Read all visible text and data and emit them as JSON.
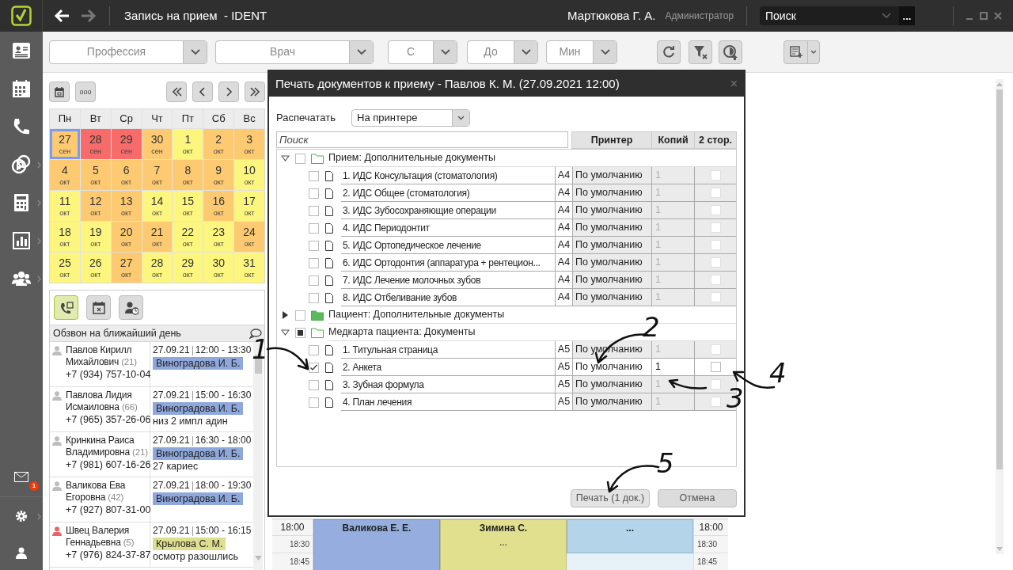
{
  "title_bar": {
    "title": "Запись на прием  - IDENT",
    "user": "Мартюкова Г. А.",
    "role": "Администратор",
    "search": {
      "value": "Поиск",
      "more": "..."
    }
  },
  "sidebar": {
    "mail_badge": "1"
  },
  "toolbar": {
    "filters": [
      {
        "placeholder": "Профессия"
      },
      {
        "placeholder": "Врач"
      },
      {
        "placeholder": "С"
      },
      {
        "placeholder": "До"
      },
      {
        "placeholder": "Мин"
      }
    ]
  },
  "calendar": {
    "more": "ooo",
    "weekdays": [
      "Пн",
      "Вт",
      "Ср",
      "Чт",
      "Пт",
      "Сб",
      "Вс"
    ],
    "days": [
      {
        "day": "27",
        "month": "сен",
        "color": "#fdca72",
        "selected": true
      },
      {
        "day": "28",
        "month": "сен",
        "color": "#f76b6b",
        "selected": false
      },
      {
        "day": "29",
        "month": "сен",
        "color": "#f76b6b",
        "selected": false
      },
      {
        "day": "30",
        "month": "сен",
        "color": "#fdca72",
        "selected": false
      },
      {
        "day": "1",
        "month": "окт",
        "color": "#fdf67e",
        "selected": false
      },
      {
        "day": "2",
        "month": "окт",
        "color": "#fdca72",
        "selected": false
      },
      {
        "day": "3",
        "month": "окт",
        "color": "#fdca72",
        "selected": false
      },
      {
        "day": "4",
        "month": "окт",
        "color": "#fdca72",
        "selected": false
      },
      {
        "day": "5",
        "month": "окт",
        "color": "#fdca72",
        "selected": false
      },
      {
        "day": "6",
        "month": "окт",
        "color": "#fdca72",
        "selected": false
      },
      {
        "day": "7",
        "month": "окт",
        "color": "#fdca72",
        "selected": false
      },
      {
        "day": "8",
        "month": "окт",
        "color": "#fdca72",
        "selected": false
      },
      {
        "day": "9",
        "month": "окт",
        "color": "#fdca72",
        "selected": false
      },
      {
        "day": "10",
        "month": "окт",
        "color": "#fdf67e",
        "selected": false
      },
      {
        "day": "11",
        "month": "окт",
        "color": "#fdf67e",
        "selected": false
      },
      {
        "day": "12",
        "month": "окт",
        "color": "#fdca72",
        "selected": false
      },
      {
        "day": "13",
        "month": "окт",
        "color": "#fdca72",
        "selected": false
      },
      {
        "day": "14",
        "month": "окт",
        "color": "#fdf67e",
        "selected": false
      },
      {
        "day": "15",
        "month": "окт",
        "color": "#fdf67e",
        "selected": false
      },
      {
        "day": "16",
        "month": "окт",
        "color": "#fdca72",
        "selected": false
      },
      {
        "day": "17",
        "month": "окт",
        "color": "#fdf67e",
        "selected": false
      },
      {
        "day": "18",
        "month": "окт",
        "color": "#fdf67e",
        "selected": false
      },
      {
        "day": "19",
        "month": "окт",
        "color": "#fdf67e",
        "selected": false
      },
      {
        "day": "20",
        "month": "окт",
        "color": "#fdca72",
        "selected": false
      },
      {
        "day": "21",
        "month": "окт",
        "color": "#fdca72",
        "selected": false
      },
      {
        "day": "22",
        "month": "окт",
        "color": "#fdf67e",
        "selected": false
      },
      {
        "day": "23",
        "month": "окт",
        "color": "#fdf67e",
        "selected": false
      },
      {
        "day": "24",
        "month": "окт",
        "color": "#fdca72",
        "selected": false
      },
      {
        "day": "25",
        "month": "окт",
        "color": "#fdf67e",
        "selected": false
      },
      {
        "day": "26",
        "month": "окт",
        "color": "#fdf67e",
        "selected": false
      },
      {
        "day": "27",
        "month": "окт",
        "color": "#fdca72",
        "selected": false
      },
      {
        "day": "28",
        "month": "окт",
        "color": "#fdf67e",
        "selected": false
      },
      {
        "day": "29",
        "month": "окт",
        "color": "#fdf67e",
        "selected": false
      },
      {
        "day": "30",
        "month": "окт",
        "color": "#fdf67e",
        "selected": false
      },
      {
        "day": "31",
        "month": "окт",
        "color": "#fdf67e",
        "selected": false
      }
    ]
  },
  "call_list": {
    "tabs": [
      {
        "selected": true
      },
      {
        "selected": false
      },
      {
        "selected": false
      }
    ],
    "title": "Обзвон на ближайший день",
    "patients": [
      {
        "name": "Павлов Кирилл Михайлович",
        "age": "(21)",
        "phone": "+7 (934) 757-10-04",
        "date": "27.09.21",
        "time": "12:00 - 13:30",
        "doctor": {
          "name": "Виноградова И. Б.",
          "color": "#8fa8dc"
        },
        "person_icon": {
          "color": "#bdbdbd"
        }
      },
      {
        "name": "Павлова Лидия Исмаиловна",
        "age": "(66)",
        "phone": "+7 (965) 357-26-06",
        "date": "27.09.21",
        "time": "15:00 - 16:30",
        "doctor": {
          "name": "Виноградова И. Б.",
          "color": "#8fa8dc"
        },
        "note": "низ 2 импл адин",
        "person_icon": {
          "color": "#bdbdbd"
        }
      },
      {
        "name": "Кринкина Раиса Владимировна",
        "age": "(21)",
        "phone": "+7 (981) 607-16-26",
        "date": "27.09.21",
        "time": "16:30 - 18:00",
        "doctor": {
          "name": "Виноградова И. Б.",
          "color": "#8fa8dc"
        },
        "note": "27 кариес",
        "person_icon": {
          "color": "#bdbdbd"
        }
      },
      {
        "name": "Валикова Ева Егоровна",
        "age": "(42)",
        "phone": "+7 (927) 807-31-00",
        "date": "27.09.21",
        "time": "18:00 - 19:30",
        "doctor": {
          "name": "Виноградова И. Б.",
          "color": "#8fa8dc"
        },
        "person_icon": {
          "color": "#bdbdbd"
        }
      },
      {
        "name": "Швец Валерия Геннадьевна",
        "age": "(5)",
        "phone": "+7 (976) 824-37-87",
        "date": "27.09.21",
        "time": "15:00 - 16:15",
        "doctor": {
          "name": "Крылова С. М.",
          "color": "#dede8e"
        },
        "note": "осмотр разошлись",
        "person_icon": {
          "color": "#f06060"
        }
      }
    ]
  },
  "dialog": {
    "title": "Печать документов к приему - Павлов К. М. (27.09.2021 12:00)",
    "close": "×",
    "print_label": "Распечатать",
    "print_target": "На принтере",
    "search": {
      "placeholder": "Поиск"
    },
    "columns": [
      "Принтер",
      "Копий",
      "2 стор."
    ],
    "groups": [
      {
        "label": "Прием: Дополнительные документы",
        "expanded": true,
        "checked": false,
        "partial": false,
        "children": [
          {
            "label": "1. ИДС Консультация (стоматология)",
            "format": "A4",
            "printer": "По умолчанию",
            "copies": "1",
            "checked": false,
            "duplex": false
          },
          {
            "label": "2. ИДС Общее (стоматология)",
            "format": "A4",
            "printer": "По умолчанию",
            "copies": "1",
            "checked": false,
            "duplex": false
          },
          {
            "label": "3. ИДС Зубосохраняющие операции",
            "format": "A4",
            "printer": "По умолчанию",
            "copies": "1",
            "checked": false,
            "duplex": false
          },
          {
            "label": "4. ИДС Периодонтит",
            "format": "A4",
            "printer": "По умолчанию",
            "copies": "1",
            "checked": false,
            "duplex": false
          },
          {
            "label": "5. ИДС Ортопедическое лечение",
            "format": "A4",
            "printer": "По умолчанию",
            "copies": "1",
            "checked": false,
            "duplex": false
          },
          {
            "label": "6. ИДС Ортодонтия (аппаратура + рентецион...",
            "format": "A4",
            "printer": "По умолчанию",
            "copies": "1",
            "checked": false,
            "duplex": false
          },
          {
            "label": "7. ИДС Лечение молочных зубов",
            "format": "A4",
            "printer": "По умолчанию",
            "copies": "1",
            "checked": false,
            "duplex": false
          },
          {
            "label": "8. ИДС Отбеливание зубов",
            "format": "A4",
            "printer": "По умолчанию",
            "copies": "1",
            "checked": false,
            "duplex": false
          }
        ]
      },
      {
        "label": "Пациент: Дополнительные документы",
        "expanded": false,
        "checked": false,
        "partial": false
      },
      {
        "label": "Медкарта пациента: Документы",
        "expanded": true,
        "checked": false,
        "partial": true,
        "children": [
          {
            "label": "1. Титульная страница",
            "format": "A5",
            "printer": "По умолчанию",
            "copies": "1",
            "checked": false,
            "duplex": false
          },
          {
            "label": "2. Анкета",
            "format": "A5",
            "printer": "По умолчанию",
            "copies": "1",
            "checked": true,
            "duplex": false
          },
          {
            "label": "3. Зубная формула",
            "format": "A5",
            "printer": "По умолчанию",
            "copies": "1",
            "checked": false,
            "duplex": false
          },
          {
            "label": "4. План лечения",
            "format": "A5",
            "printer": "По умолчанию",
            "copies": "1",
            "checked": false,
            "duplex": false
          }
        ]
      }
    ],
    "buttons": {
      "print": "Печать (1 док.)",
      "cancel": "Отмена"
    }
  },
  "schedule": {
    "left_times": [
      "18:00",
      "18:30",
      "18:45"
    ],
    "right_times": [
      "18:00",
      "18:30",
      "18:45"
    ],
    "columns": [
      {
        "name": "Валикова Е. Е.",
        "color": "#95aedf"
      },
      {
        "name": "Зимина С.",
        "note": "...",
        "color": "#e0e08e"
      },
      {
        "name": "...",
        "color": "#b4d4ea"
      }
    ]
  },
  "annotations": [
    {
      "label": "1"
    },
    {
      "label": "2"
    },
    {
      "label": "3"
    },
    {
      "label": "4"
    },
    {
      "label": "5"
    }
  ]
}
